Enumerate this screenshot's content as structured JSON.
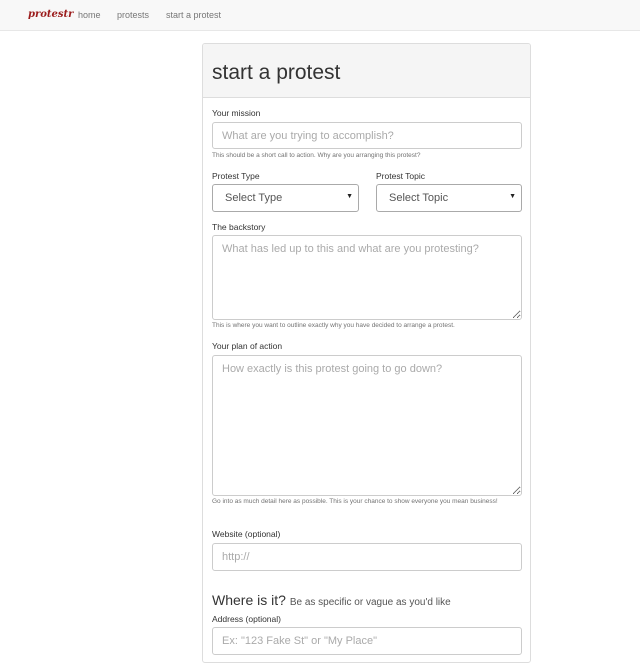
{
  "nav": {
    "brand": "protestr",
    "links": [
      "home",
      "protests",
      "start a protest"
    ]
  },
  "form": {
    "title": "start a protest",
    "mission": {
      "label": "Your mission",
      "placeholder": "What are you trying to accomplish?",
      "help": "This should be a short call to action. Why are you arranging this protest?"
    },
    "type": {
      "label": "Protest Type",
      "value": "Select Type"
    },
    "topic": {
      "label": "Protest Topic",
      "value": "Select Topic"
    },
    "backstory": {
      "label": "The backstory",
      "placeholder": "What has led up to this and what are you protesting?",
      "help": "This is where you want to outline exactly why you have decided to arrange a protest."
    },
    "plan": {
      "label": "Your plan of action",
      "placeholder": "How exactly is this protest going to go down?",
      "help": "Go into as much detail here as possible. This is your chance to show everyone you mean business!"
    },
    "website": {
      "label": "Website (optional)",
      "placeholder": "http://"
    },
    "location": {
      "title": "Where is it?",
      "subtitle": "Be as specific or vague as you'd like"
    },
    "address": {
      "label": "Address (optional)",
      "placeholder": "Ex: \"123 Fake St\" or \"My Place\""
    }
  },
  "colors": {
    "brand": "#9b1c1c",
    "navbar_bg": "#f8f8f8",
    "panel_head_bg": "#f5f5f5"
  },
  "icons": {
    "select_caret": "caret-down-icon"
  }
}
